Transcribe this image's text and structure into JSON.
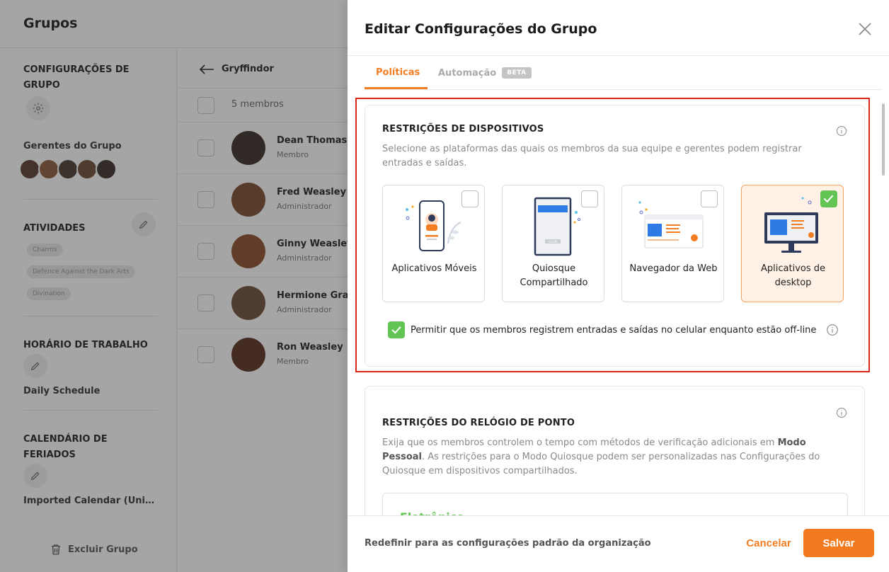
{
  "background": {
    "title": "Grupos",
    "sidebar": {
      "config_heading": "CONFIGURAÇÕES DE GRUPO",
      "managers_label": "Gerentes do Grupo",
      "activities_heading": "ATIVIDADES",
      "activities": [
        "Charms",
        "Defence Against the Dark Arts",
        "Divination"
      ],
      "schedule_heading": "HORÁRIO DE TRABALHO",
      "schedule_value": "Daily Schedule",
      "holiday_heading": "CALENDÁRIO DE FERIADOS",
      "holiday_value": "Imported Calendar (United States)",
      "delete_label": "Excluir Grupo"
    },
    "main": {
      "group_name": "Gryffindor",
      "members_count": "5 membros",
      "members": [
        {
          "name": "Dean Thomas",
          "role": "Membro"
        },
        {
          "name": "Fred Weasley",
          "role": "Administrador"
        },
        {
          "name": "Ginny Weasley",
          "role": "Administrador"
        },
        {
          "name": "Hermione Granger",
          "role": "Administrador"
        },
        {
          "name": "Ron Weasley",
          "role": "Membro"
        }
      ]
    }
  },
  "drawer": {
    "title": "Editar Configurações do Grupo",
    "tabs": {
      "active": "Políticas",
      "inactive": "Automação",
      "beta": "BETA"
    },
    "device_card": {
      "title": "RESTRIÇÕES DE DISPOSITIVOS",
      "description": "Selecione as plataformas das quais os membros da sua equipe e gerentes podem registrar entradas e saídas.",
      "platforms": [
        {
          "label": "Aplicativos Móveis",
          "checked": false,
          "icon": "mobile-app-icon"
        },
        {
          "label": "Quiosque Compartilhado",
          "checked": false,
          "icon": "kiosk-icon"
        },
        {
          "label": "Navegador da Web",
          "checked": false,
          "icon": "web-browser-icon"
        },
        {
          "label": "Aplicativos de desktop",
          "checked": true,
          "icon": "desktop-app-icon"
        }
      ],
      "offline_text": "Permitir que os membros registrem entradas e saídas no celular enquanto estão off-line",
      "kiosk_screen_text": "SCAN"
    },
    "clock_card": {
      "title": "RESTRIÇÕES DO RELÓGIO DE PONTO",
      "description_1": "Exija que os membros controlem o tempo com métodos de verificação adicionais em ",
      "description_bold": "Modo Pessoal",
      "description_2": ". As restrições para o Modo Quiosque podem ser personalizadas nas Configurações do Quiosque em dispositivos compartilhados.",
      "inner_label": "Eletrônico"
    },
    "footer": {
      "reset": "Redefinir para as configurações padrão da organização",
      "cancel": "Cancelar",
      "save": "Salvar"
    }
  },
  "colors": {
    "accent": "#f27d22",
    "success": "#62c553",
    "highlight_frame": "#d9261c"
  }
}
